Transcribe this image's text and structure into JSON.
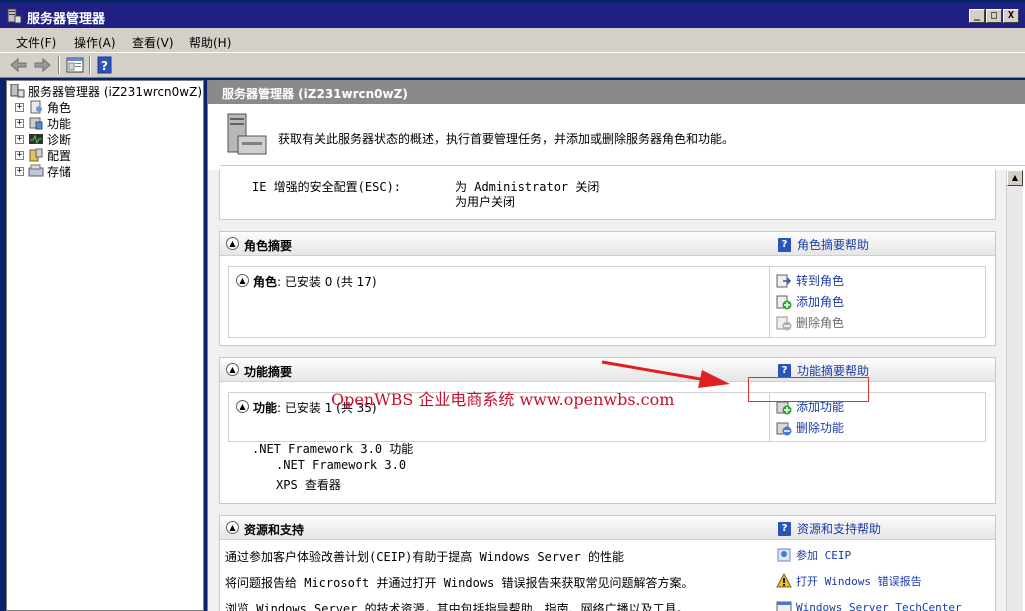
{
  "window": {
    "title": "服务器管理器",
    "controls": [
      "_",
      "□",
      "X"
    ]
  },
  "menu": [
    {
      "label": "文件(F)"
    },
    {
      "label": "操作(A)"
    },
    {
      "label": "查看(V)"
    },
    {
      "label": "帮助(H)"
    }
  ],
  "tree": {
    "root": "服务器管理器 (iZ231wrcn0wZ)",
    "items": [
      {
        "label": "角色",
        "icon": "roles-icon"
      },
      {
        "label": "功能",
        "icon": "features-icon"
      },
      {
        "label": "诊断",
        "icon": "diagnostics-icon"
      },
      {
        "label": "配置",
        "icon": "configuration-icon"
      },
      {
        "label": "存储",
        "icon": "storage-icon"
      }
    ]
  },
  "pane": {
    "header": "服务器管理器 (iZ231wrcn0wZ)",
    "intro": "获取有关此服务器状态的概述，执行首要管理任务，并添加或删除服务器角色和功能。"
  },
  "security": {
    "label": "IE 增强的安全配置(ESC):",
    "value_line1": "为 Administrator 关闭",
    "value_line2": "为用户关闭"
  },
  "roles": {
    "title": "角色摘要",
    "help": "角色摘要帮助",
    "sub_label": "角色",
    "sub_status": ": 已安装 0 (共 17)",
    "tasks": [
      "转到角色",
      "添加角色",
      "删除角色"
    ]
  },
  "features": {
    "title": "功能摘要",
    "help": "功能摘要帮助",
    "sub_label": "功能",
    "sub_status": ": 已安装 1 (共 35)",
    "tasks": [
      "添加功能",
      "删除功能"
    ],
    "installed": [
      ".NET Framework 3.0 功能",
      ".NET Framework 3.0",
      "XPS 查看器"
    ]
  },
  "resources": {
    "title": "资源和支持",
    "help": "资源和支持帮助",
    "lines": [
      "通过参加客户体验改善计划(CEIP)有助于提高 Windows Server 的性能",
      "将问题报告给 Microsoft 并通过打开 Windows 错误报告来获取常见问题解答方案。",
      "浏览 Windows Server 的技术资源，其中包括指导帮助、指南、网络广播以及工具。"
    ],
    "tasks": [
      "参加 CEIP",
      "打开 Windows 错误报告",
      "Windows Server TechCenter"
    ]
  },
  "annotation": {
    "watermark": "OpenWBS 企业电商系统 www.openwbs.com",
    "color": "#c8102e"
  }
}
